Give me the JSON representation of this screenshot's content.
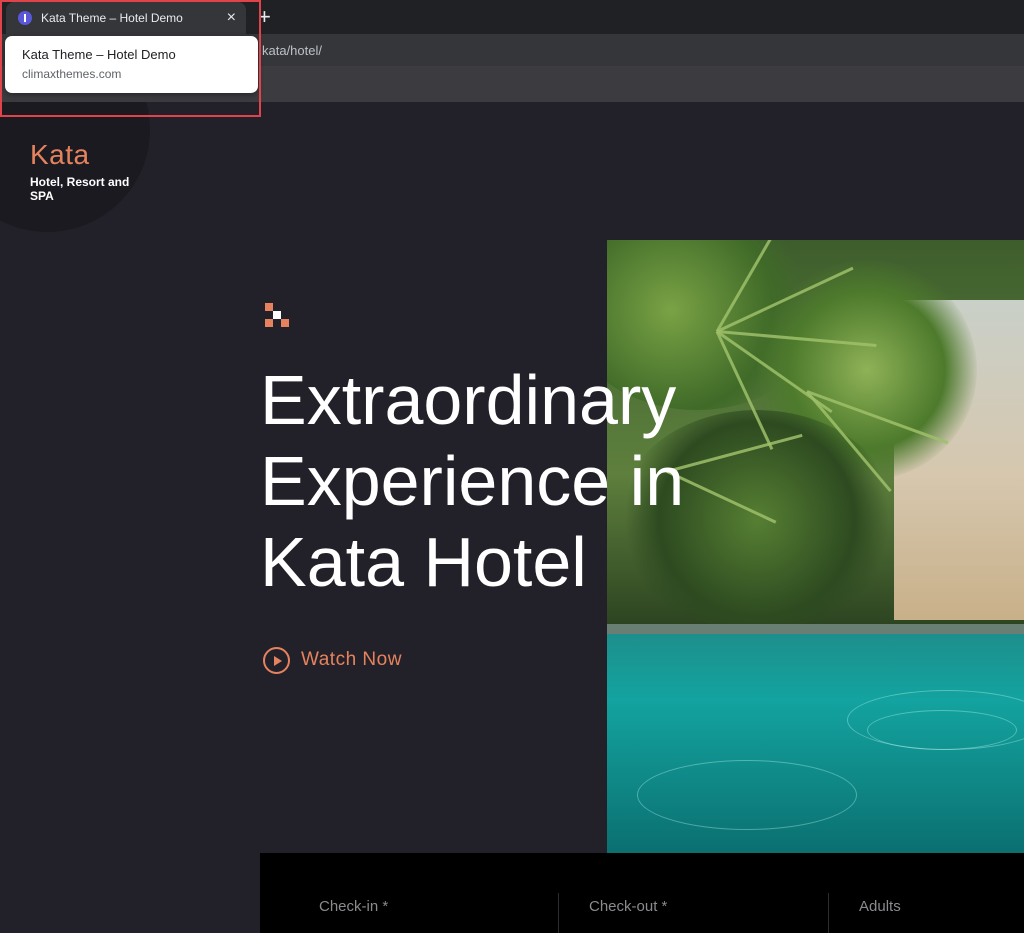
{
  "browser": {
    "tab_title": "Kata Theme – Hotel Demo",
    "tab_close": "×",
    "new_tab": "+",
    "url_partial": "kata/hotel/",
    "hover_card": {
      "title": "Kata Theme – Hotel Demo",
      "domain": "climaxthemes.com"
    }
  },
  "site": {
    "brand": "Kata",
    "tagline": "Hotel, Resort and SPA",
    "accent_color": "#e6835e",
    "hero": {
      "headline_lines": [
        "Extraordinary",
        "Experience in",
        "Kata Hotel"
      ],
      "watch_label": "Watch Now"
    },
    "booking": {
      "checkin_label": "Check-in",
      "checkout_label": "Check-out",
      "adults_label": "Adults",
      "required_mark": "*"
    }
  }
}
